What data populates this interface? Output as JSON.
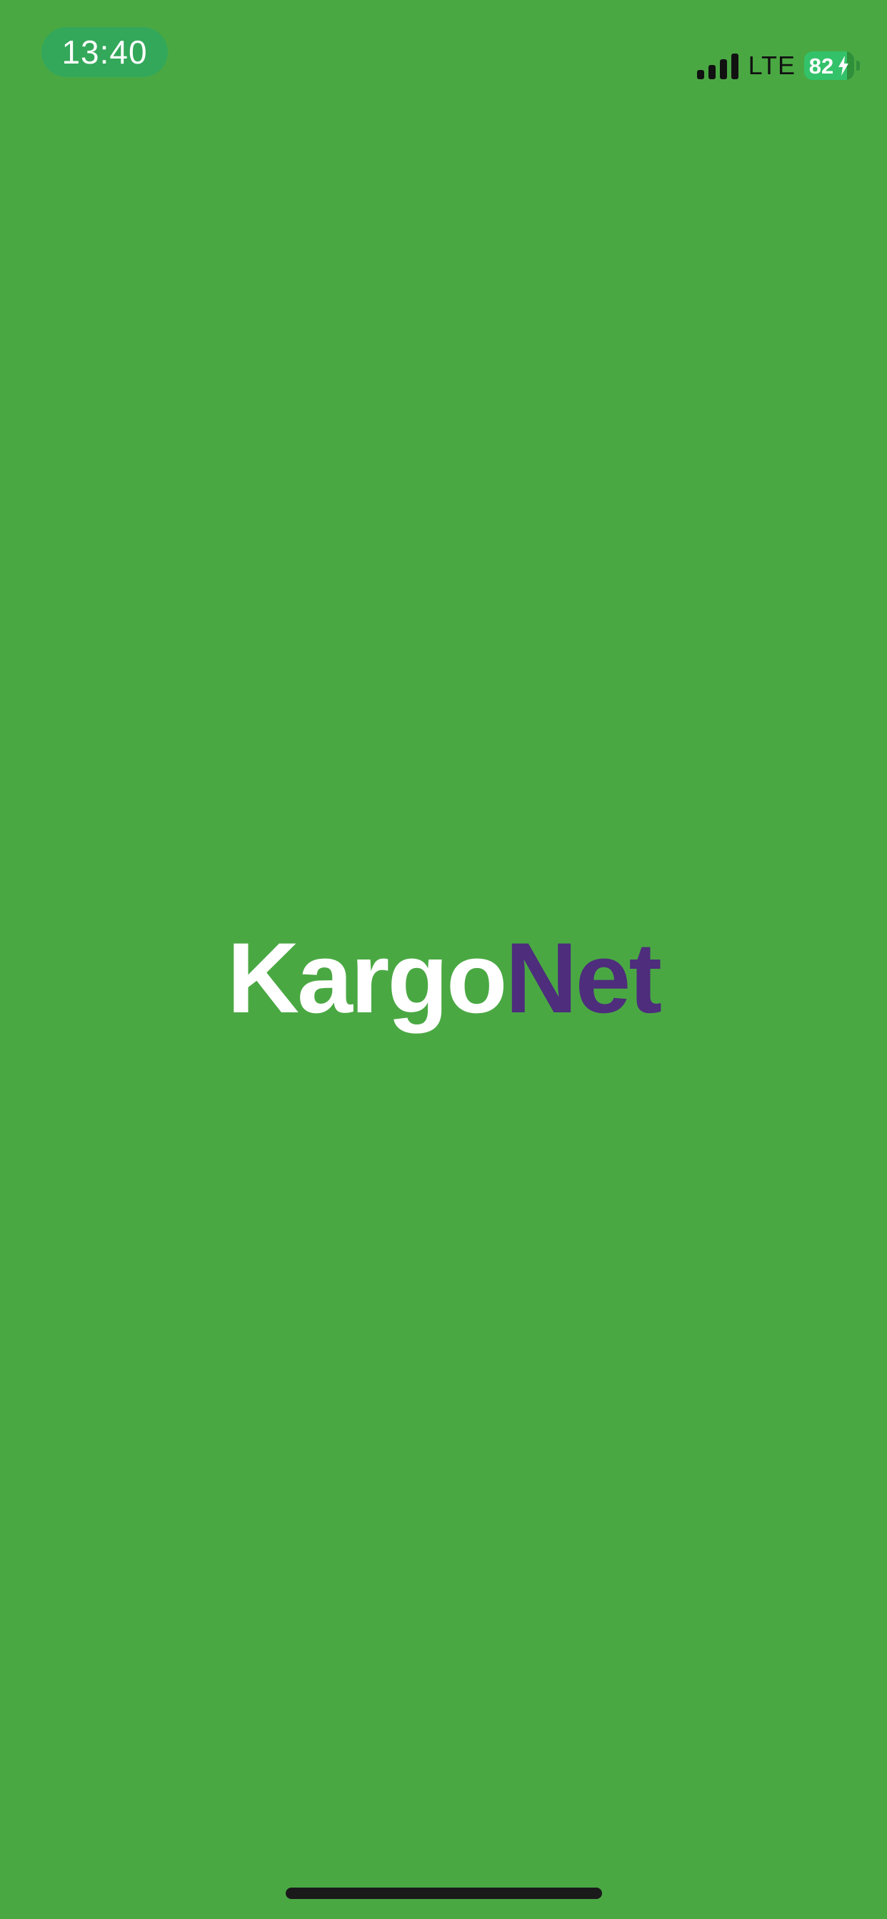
{
  "status_bar": {
    "time": "13:40",
    "network": "LTE",
    "battery": "82",
    "battery_icon": "battery-charging-icon",
    "signal_icon": "cellular-signal-icon"
  },
  "logo": {
    "part_1": "Kargo",
    "part_2": "Net"
  },
  "colors": {
    "background": "#4aa843",
    "logo_part_1": "#ffffff",
    "logo_part_2": "#4d2d7c",
    "time_pill": "#33a85a",
    "battery": "#33c26a"
  }
}
